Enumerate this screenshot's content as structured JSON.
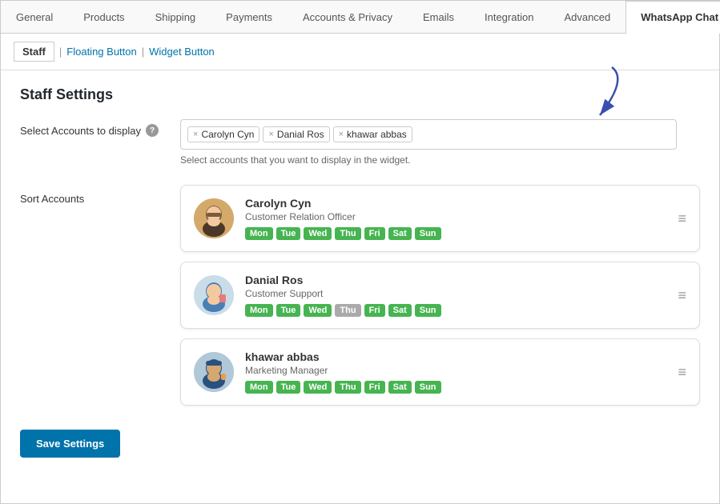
{
  "tabs": {
    "items": [
      {
        "id": "general",
        "label": "General",
        "active": false
      },
      {
        "id": "products",
        "label": "Products",
        "active": false
      },
      {
        "id": "shipping",
        "label": "Shipping",
        "active": false
      },
      {
        "id": "payments",
        "label": "Payments",
        "active": false
      },
      {
        "id": "accounts-privacy",
        "label": "Accounts & Privacy",
        "active": false
      },
      {
        "id": "emails",
        "label": "Emails",
        "active": false
      },
      {
        "id": "integration",
        "label": "Integration",
        "active": false
      },
      {
        "id": "advanced",
        "label": "Advanced",
        "active": false
      },
      {
        "id": "whatsapp-chat",
        "label": "WhatsApp Chat",
        "active": true
      }
    ]
  },
  "subtabs": {
    "items": [
      {
        "id": "staff",
        "label": "Staff",
        "active": true
      },
      {
        "id": "floating-button",
        "label": "Floating Button",
        "active": false
      },
      {
        "id": "widget-button",
        "label": "Widget Button",
        "active": false
      }
    ]
  },
  "section": {
    "title": "Staff Settings"
  },
  "select_accounts": {
    "label": "Select Accounts to display",
    "hint": "Select accounts that you want to display in the widget.",
    "tags": [
      {
        "id": "carolyn",
        "label": "Carolyn Cyn"
      },
      {
        "id": "danial",
        "label": "Danial Ros"
      },
      {
        "id": "khawar",
        "label": "khawar abbas"
      }
    ]
  },
  "sort_accounts": {
    "label": "Sort Accounts",
    "accounts": [
      {
        "id": "carolyn",
        "name": "Carolyn Cyn",
        "role": "Customer Relation Officer",
        "avatar_type": "carolyn",
        "days": [
          {
            "label": "Mon",
            "active": true
          },
          {
            "label": "Tue",
            "active": true
          },
          {
            "label": "Wed",
            "active": true
          },
          {
            "label": "Thu",
            "active": true
          },
          {
            "label": "Fri",
            "active": true
          },
          {
            "label": "Sat",
            "active": true
          },
          {
            "label": "Sun",
            "active": true
          }
        ]
      },
      {
        "id": "danial",
        "name": "Danial Ros",
        "role": "Customer Support",
        "avatar_type": "danial",
        "days": [
          {
            "label": "Mon",
            "active": true
          },
          {
            "label": "Tue",
            "active": true
          },
          {
            "label": "Wed",
            "active": true
          },
          {
            "label": "Thu",
            "active": false
          },
          {
            "label": "Fri",
            "active": true
          },
          {
            "label": "Sat",
            "active": true
          },
          {
            "label": "Sun",
            "active": true
          }
        ]
      },
      {
        "id": "khawar",
        "name": "khawar abbas",
        "role": "Marketing Manager",
        "avatar_type": "khawar",
        "days": [
          {
            "label": "Mon",
            "active": true
          },
          {
            "label": "Tue",
            "active": true
          },
          {
            "label": "Wed",
            "active": true
          },
          {
            "label": "Thu",
            "active": true
          },
          {
            "label": "Fri",
            "active": true
          },
          {
            "label": "Sat",
            "active": true
          },
          {
            "label": "Sun",
            "active": true
          }
        ]
      }
    ]
  },
  "buttons": {
    "save": "Save Settings"
  },
  "colors": {
    "active_day": "#46b450",
    "inactive_day": "#aaaaaa",
    "primary": "#0073aa"
  }
}
